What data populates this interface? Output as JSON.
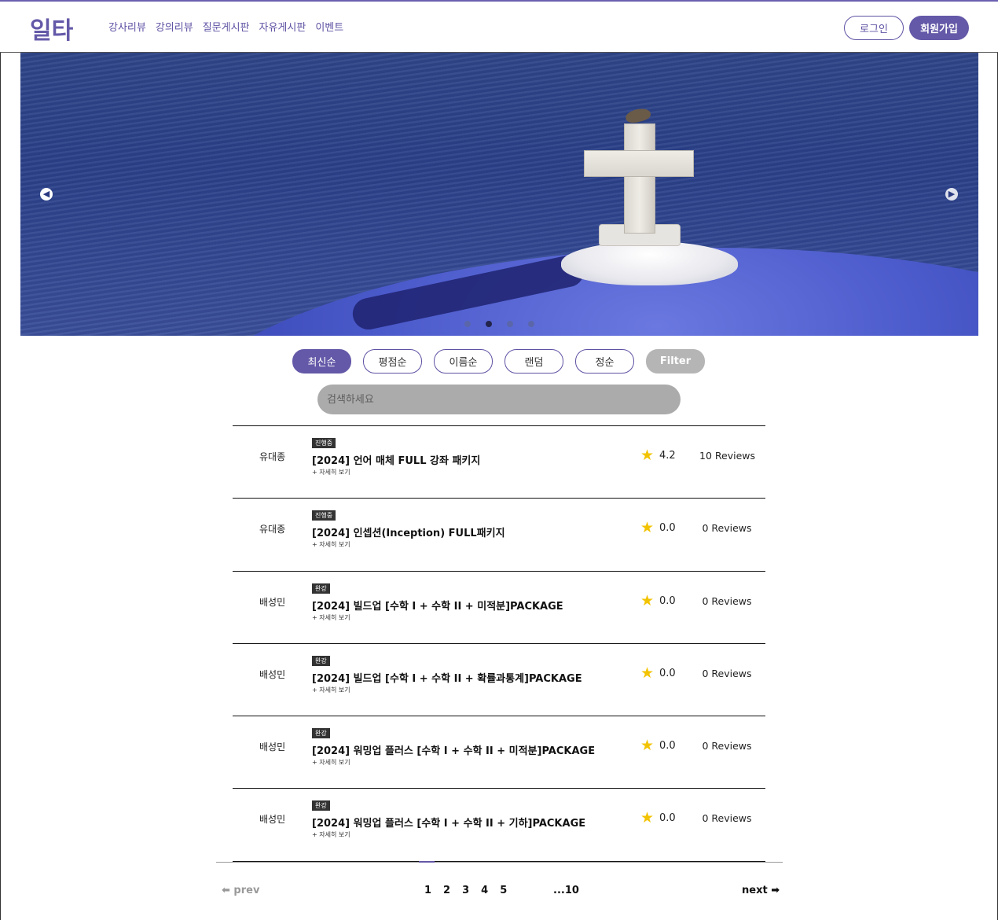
{
  "header": {
    "logo": "일타",
    "nav": [
      "강사리뷰",
      "강의리뷰",
      "질문게시판",
      "자유게시판",
      "이벤트"
    ],
    "login_label": "로그인",
    "signup_label": "회원가입"
  },
  "banner": {
    "prev_icon": "◀",
    "next_icon": "▶",
    "slide_count": 4,
    "active_slide": 2
  },
  "sort": {
    "buttons": [
      "최신순",
      "평점순",
      "이름순",
      "랜덤",
      "정순"
    ],
    "filter_label": "Filter",
    "active": "최신순"
  },
  "search": {
    "placeholder": "검색하세요"
  },
  "courses": [
    {
      "instructor": "유대종",
      "status": "진행중",
      "title": "[2024] 언어 매체 FULL 강좌 패키지",
      "more": "+ 자세히 보기",
      "rating": "4.2",
      "reviews": "10 Reviews"
    },
    {
      "instructor": "유대종",
      "status": "진행중",
      "title": "[2024] 인셉션(Inception) FULL패키지",
      "more": "+ 자세히 보기",
      "rating": "0.0",
      "reviews": "0 Reviews"
    },
    {
      "instructor": "배성민",
      "status": "완강",
      "title": "[2024] 빌드업 [수학 I + 수학 II + 미적분]PACKAGE",
      "more": "+ 자세히 보기",
      "rating": "0.0",
      "reviews": "0 Reviews"
    },
    {
      "instructor": "배성민",
      "status": "완강",
      "title": "[2024] 빌드업 [수학 I + 수학 II + 확률과통계]PACKAGE",
      "more": "+ 자세히 보기",
      "rating": "0.0",
      "reviews": "0 Reviews"
    },
    {
      "instructor": "배성민",
      "status": "완강",
      "title": "[2024] 워밍업 플러스 [수학 I + 수학 II + 미적분]PACKAGE",
      "more": "+ 자세히 보기",
      "rating": "0.0",
      "reviews": "0 Reviews"
    },
    {
      "instructor": "배성민",
      "status": "완강",
      "title": "[2024] 워밍업 플러스 [수학 I + 수학 II + 기하]PACKAGE",
      "more": "+ 자세히 보기",
      "rating": "0.0",
      "reviews": "0 Reviews"
    }
  ],
  "pagination": {
    "prev": "⬅ prev",
    "pages": [
      "1",
      "2",
      "3",
      "4",
      "5"
    ],
    "last": "...10",
    "next": "next ➡"
  },
  "colors": {
    "accent": "#6459a8",
    "star": "#f2c300",
    "filter": "#b5b5b5"
  }
}
